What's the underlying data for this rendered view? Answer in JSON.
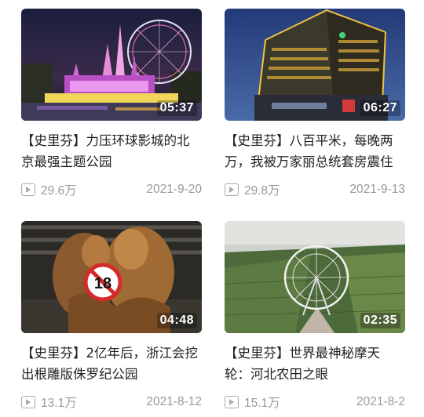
{
  "videos": [
    {
      "title": "【史里芬】力压环球影城的北京最强主题公园",
      "duration": "05:37",
      "views": "29.6万",
      "date": "2021-9-20",
      "thumb_icon": "castle-ferris-wheel-night-thumbnail"
    },
    {
      "title": "【史里芬】八百平米，每晚两万，我被万家丽总统套房震住",
      "duration": "06:27",
      "views": "29.8万",
      "date": "2021-9-13",
      "thumb_icon": "lit-hotel-tower-thumbnail"
    },
    {
      "title": "【史里芬】2亿年后，浙江会挖出根雕版侏罗纪公园",
      "duration": "04:48",
      "views": "13.1万",
      "date": "2021-8-12",
      "thumb_icon": "wood-carving-sculpture-thumbnail"
    },
    {
      "title": "【史里芬】世界最神秘摩天轮：河北农田之眼",
      "duration": "02:35",
      "views": "15.1万",
      "date": "2021-8-2",
      "thumb_icon": "farmland-ferris-wheel-thumbnail"
    }
  ]
}
